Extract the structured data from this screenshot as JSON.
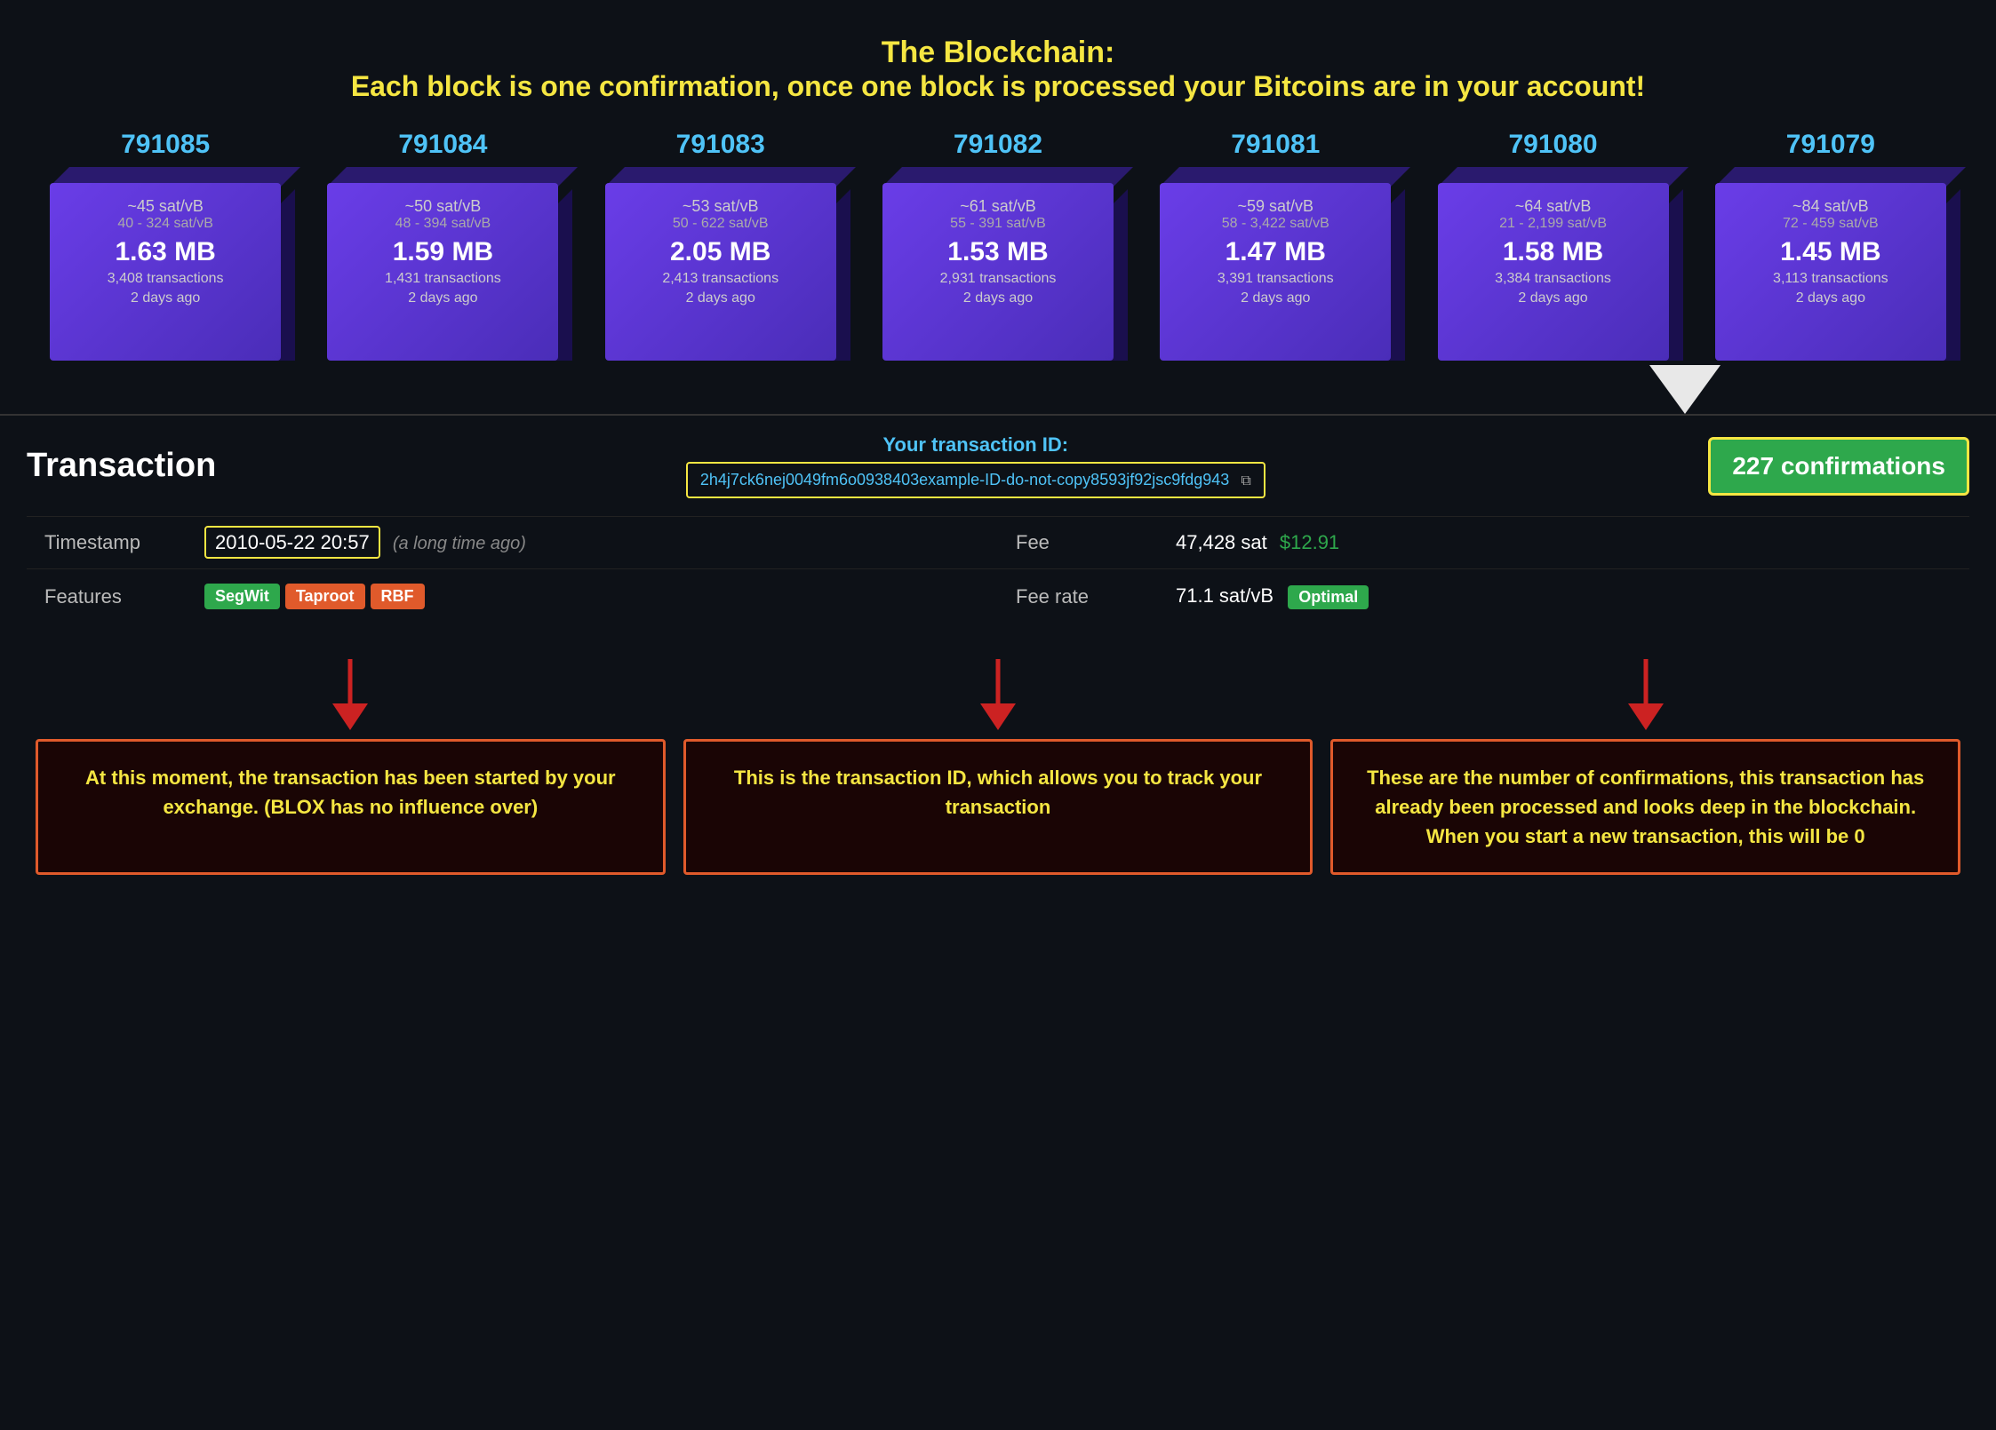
{
  "header": {
    "line1": "The Blockchain:",
    "line2": "Each block is one confirmation, once one block is processed your Bitcoins are in your account!"
  },
  "blocks": [
    {
      "number": "791085",
      "sat_rate": "~45 sat/vB",
      "sat_range": "40 - 324 sat/vB",
      "size": "1.63 MB",
      "transactions": "3,408 transactions",
      "time": "2 days ago"
    },
    {
      "number": "791084",
      "sat_rate": "~50 sat/vB",
      "sat_range": "48 - 394 sat/vB",
      "size": "1.59 MB",
      "transactions": "1,431 transactions",
      "time": "2 days ago"
    },
    {
      "number": "791083",
      "sat_rate": "~53 sat/vB",
      "sat_range": "50 - 622 sat/vB",
      "size": "2.05 MB",
      "transactions": "2,413 transactions",
      "time": "2 days ago"
    },
    {
      "number": "791082",
      "sat_rate": "~61 sat/vB",
      "sat_range": "55 - 391 sat/vB",
      "size": "1.53 MB",
      "transactions": "2,931 transactions",
      "time": "2 days ago"
    },
    {
      "number": "791081",
      "sat_rate": "~59 sat/vB",
      "sat_range": "58 - 3,422 sat/vB",
      "size": "1.47 MB",
      "transactions": "3,391 transactions",
      "time": "2 days ago"
    },
    {
      "number": "791080",
      "sat_rate": "~64 sat/vB",
      "sat_range": "21 - 2,199 sat/vB",
      "size": "1.58 MB",
      "transactions": "3,384 transactions",
      "time": "2 days ago"
    },
    {
      "number": "791079",
      "sat_rate": "~84 sat/vB",
      "sat_range": "72 - 459 sat/vB",
      "size": "1.45 MB",
      "transactions": "3,113 transactions",
      "time": "2 days ago"
    }
  ],
  "transaction": {
    "title": "Transaction",
    "id_label": "Your transaction ID:",
    "id_value": "2h4j7ck6nej0049fm6o0938403example-ID-do-not-copy8593jf92jsc9fdg943",
    "confirmations": "227 confirmations",
    "timestamp_label": "Timestamp",
    "timestamp_value": "2010-05-22 20:57",
    "timestamp_ago": "(a long time ago)",
    "features_label": "Features",
    "features": [
      "SegWit",
      "Taproot",
      "RBF"
    ],
    "fee_label": "Fee",
    "fee_sat": "47,428 sat",
    "fee_usd": "$12.91",
    "fee_rate_label": "Fee rate",
    "fee_rate_value": "71.1 sat/vB",
    "fee_rate_status": "Optimal"
  },
  "annotations": [
    {
      "text": "At this moment, the transaction has been started by your exchange. (BLOX has no influence over)"
    },
    {
      "text": "This is the transaction ID, which allows you to track your transaction"
    },
    {
      "text": "These are the number of confirmations, this transaction has already been processed and looks deep in the blockchain. When you start a new transaction, this will be 0"
    }
  ]
}
